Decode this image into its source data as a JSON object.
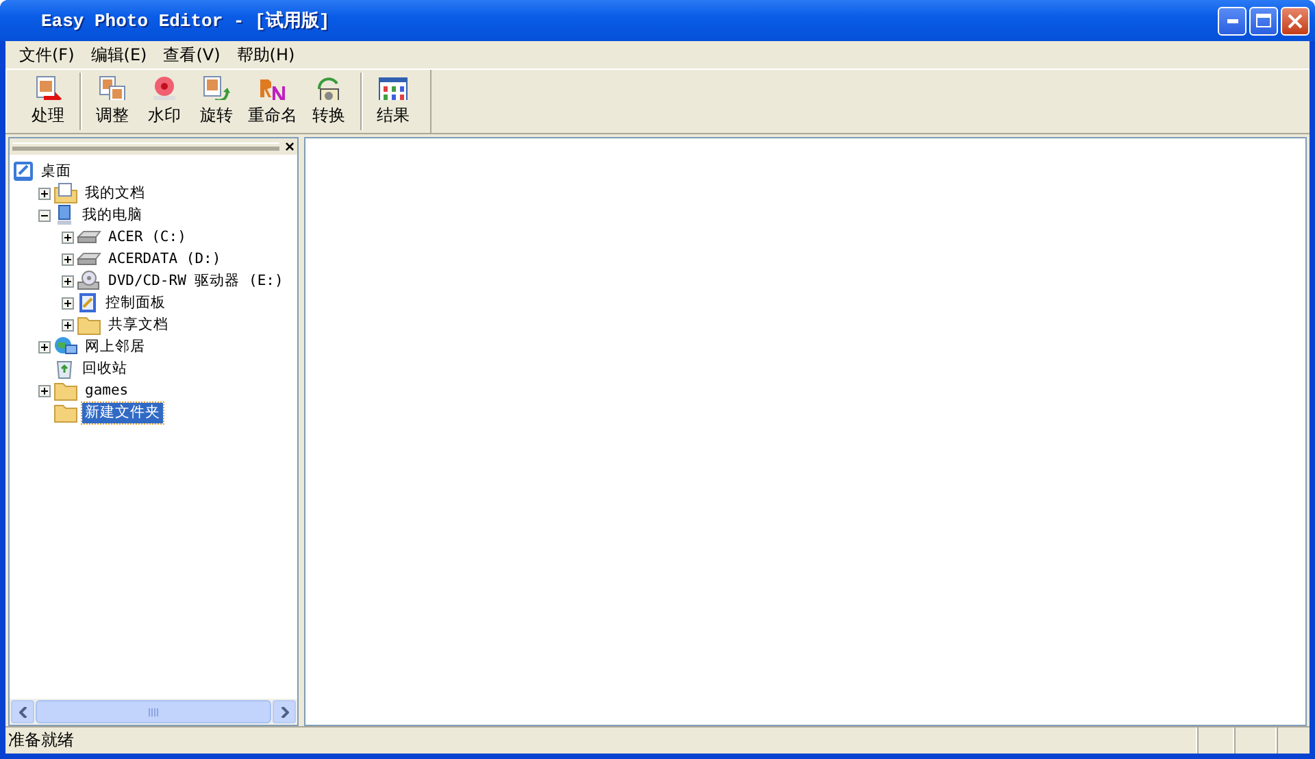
{
  "window": {
    "title": "Easy Photo Editor - [试用版]"
  },
  "menu": [
    "文件(F)",
    "编辑(E)",
    "查看(V)",
    "帮助(H)"
  ],
  "toolbar": {
    "groups": [
      [
        {
          "label": "处理",
          "kind": "process"
        }
      ],
      [
        {
          "label": "调整",
          "kind": "adjust"
        },
        {
          "label": "水印",
          "kind": "watermark"
        },
        {
          "label": "旋转",
          "kind": "rotate"
        },
        {
          "label": "重命名",
          "kind": "rename"
        },
        {
          "label": "转换",
          "kind": "convert"
        }
      ],
      [
        {
          "label": "结果",
          "kind": "result"
        }
      ]
    ]
  },
  "tree": {
    "close": "×",
    "items": [
      {
        "label": "桌面",
        "kind": "desktop",
        "selected": false,
        "children": [
          {
            "label": "我的文档",
            "kind": "documents",
            "expanded": false,
            "selected": false
          },
          {
            "label": "我的电脑",
            "kind": "computer",
            "expanded": true,
            "selected": false,
            "children": [
              {
                "label": "ACER (C:)",
                "kind": "drive",
                "expanded": false,
                "selected": false
              },
              {
                "label": "ACERDATA (D:)",
                "kind": "drive",
                "expanded": false,
                "selected": false
              },
              {
                "label": "DVD/CD-RW 驱动器 (E:)",
                "kind": "cdrom",
                "expanded": false,
                "selected": false
              },
              {
                "label": "控制面板",
                "kind": "control-panel",
                "expanded": false,
                "selected": false
              },
              {
                "label": "共享文档",
                "kind": "folder",
                "expanded": false,
                "selected": false
              }
            ]
          },
          {
            "label": "网上邻居",
            "kind": "network",
            "expanded": false,
            "selected": false
          },
          {
            "label": "回收站",
            "kind": "recycle-bin",
            "selected": false
          },
          {
            "label": "games",
            "kind": "folder",
            "expanded": false,
            "selected": false
          },
          {
            "label": "新建文件夹",
            "kind": "folder",
            "selected": true
          }
        ]
      }
    ]
  },
  "status_bar": {
    "text": "准备就绪"
  }
}
